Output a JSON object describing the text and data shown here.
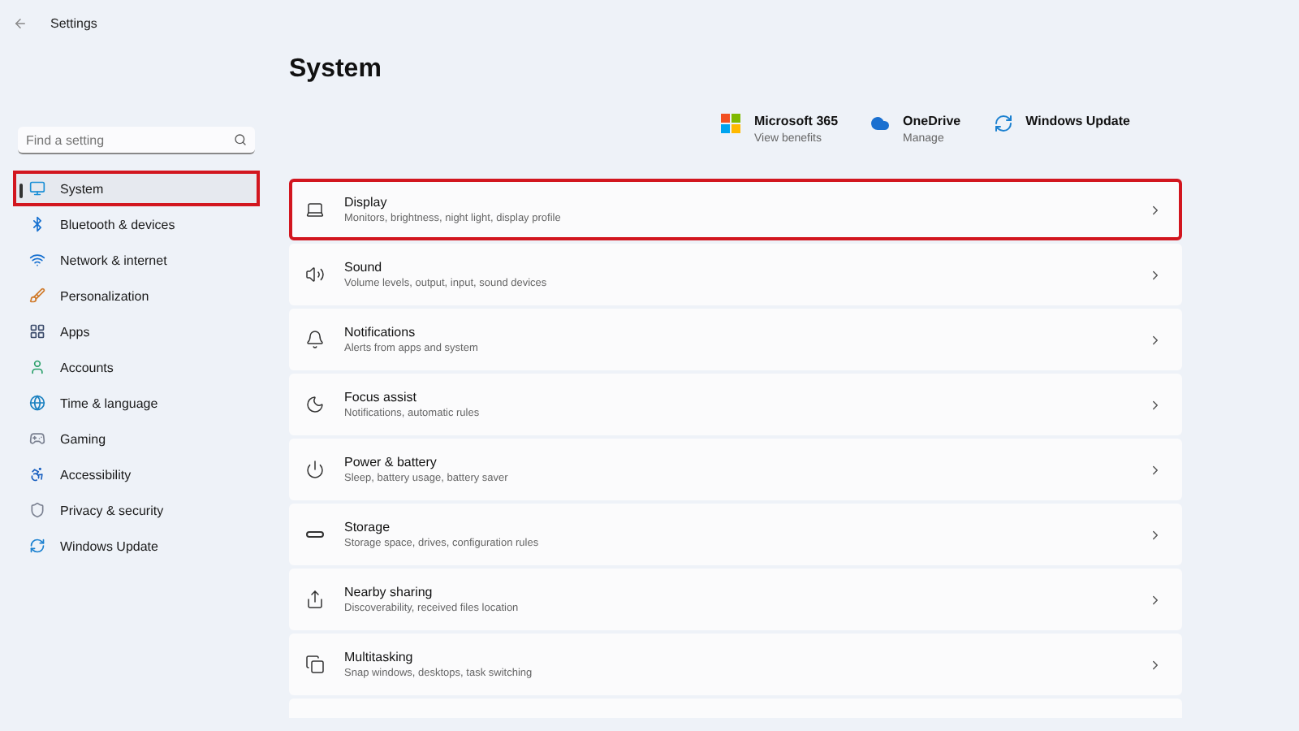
{
  "window": {
    "title": "Settings"
  },
  "search": {
    "placeholder": "Find a setting"
  },
  "sidebar": {
    "items": [
      {
        "label": "System",
        "selected": true,
        "highlighted": true
      },
      {
        "label": "Bluetooth & devices",
        "selected": false,
        "highlighted": false
      },
      {
        "label": "Network & internet",
        "selected": false,
        "highlighted": false
      },
      {
        "label": "Personalization",
        "selected": false,
        "highlighted": false
      },
      {
        "label": "Apps",
        "selected": false,
        "highlighted": false
      },
      {
        "label": "Accounts",
        "selected": false,
        "highlighted": false
      },
      {
        "label": "Time & language",
        "selected": false,
        "highlighted": false
      },
      {
        "label": "Gaming",
        "selected": false,
        "highlighted": false
      },
      {
        "label": "Accessibility",
        "selected": false,
        "highlighted": false
      },
      {
        "label": "Privacy & security",
        "selected": false,
        "highlighted": false
      },
      {
        "label": "Windows Update",
        "selected": false,
        "highlighted": false
      }
    ]
  },
  "page_title": "System",
  "quick_links": [
    {
      "title": "Microsoft 365",
      "subtitle": "View benefits"
    },
    {
      "title": "OneDrive",
      "subtitle": "Manage"
    },
    {
      "title": "Windows Update"
    }
  ],
  "cards": [
    {
      "title": "Display",
      "subtitle": "Monitors, brightness, night light, display profile",
      "highlighted": true
    },
    {
      "title": "Sound",
      "subtitle": "Volume levels, output, input, sound devices",
      "highlighted": false
    },
    {
      "title": "Notifications",
      "subtitle": "Alerts from apps and system",
      "highlighted": false
    },
    {
      "title": "Focus assist",
      "subtitle": "Notifications, automatic rules",
      "highlighted": false
    },
    {
      "title": "Power & battery",
      "subtitle": "Sleep, battery usage, battery saver",
      "highlighted": false
    },
    {
      "title": "Storage",
      "subtitle": "Storage space, drives, configuration rules",
      "highlighted": false
    },
    {
      "title": "Nearby sharing",
      "subtitle": "Discoverability, received files location",
      "highlighted": false
    },
    {
      "title": "Multitasking",
      "subtitle": "Snap windows, desktops, task switching",
      "highlighted": false
    }
  ]
}
